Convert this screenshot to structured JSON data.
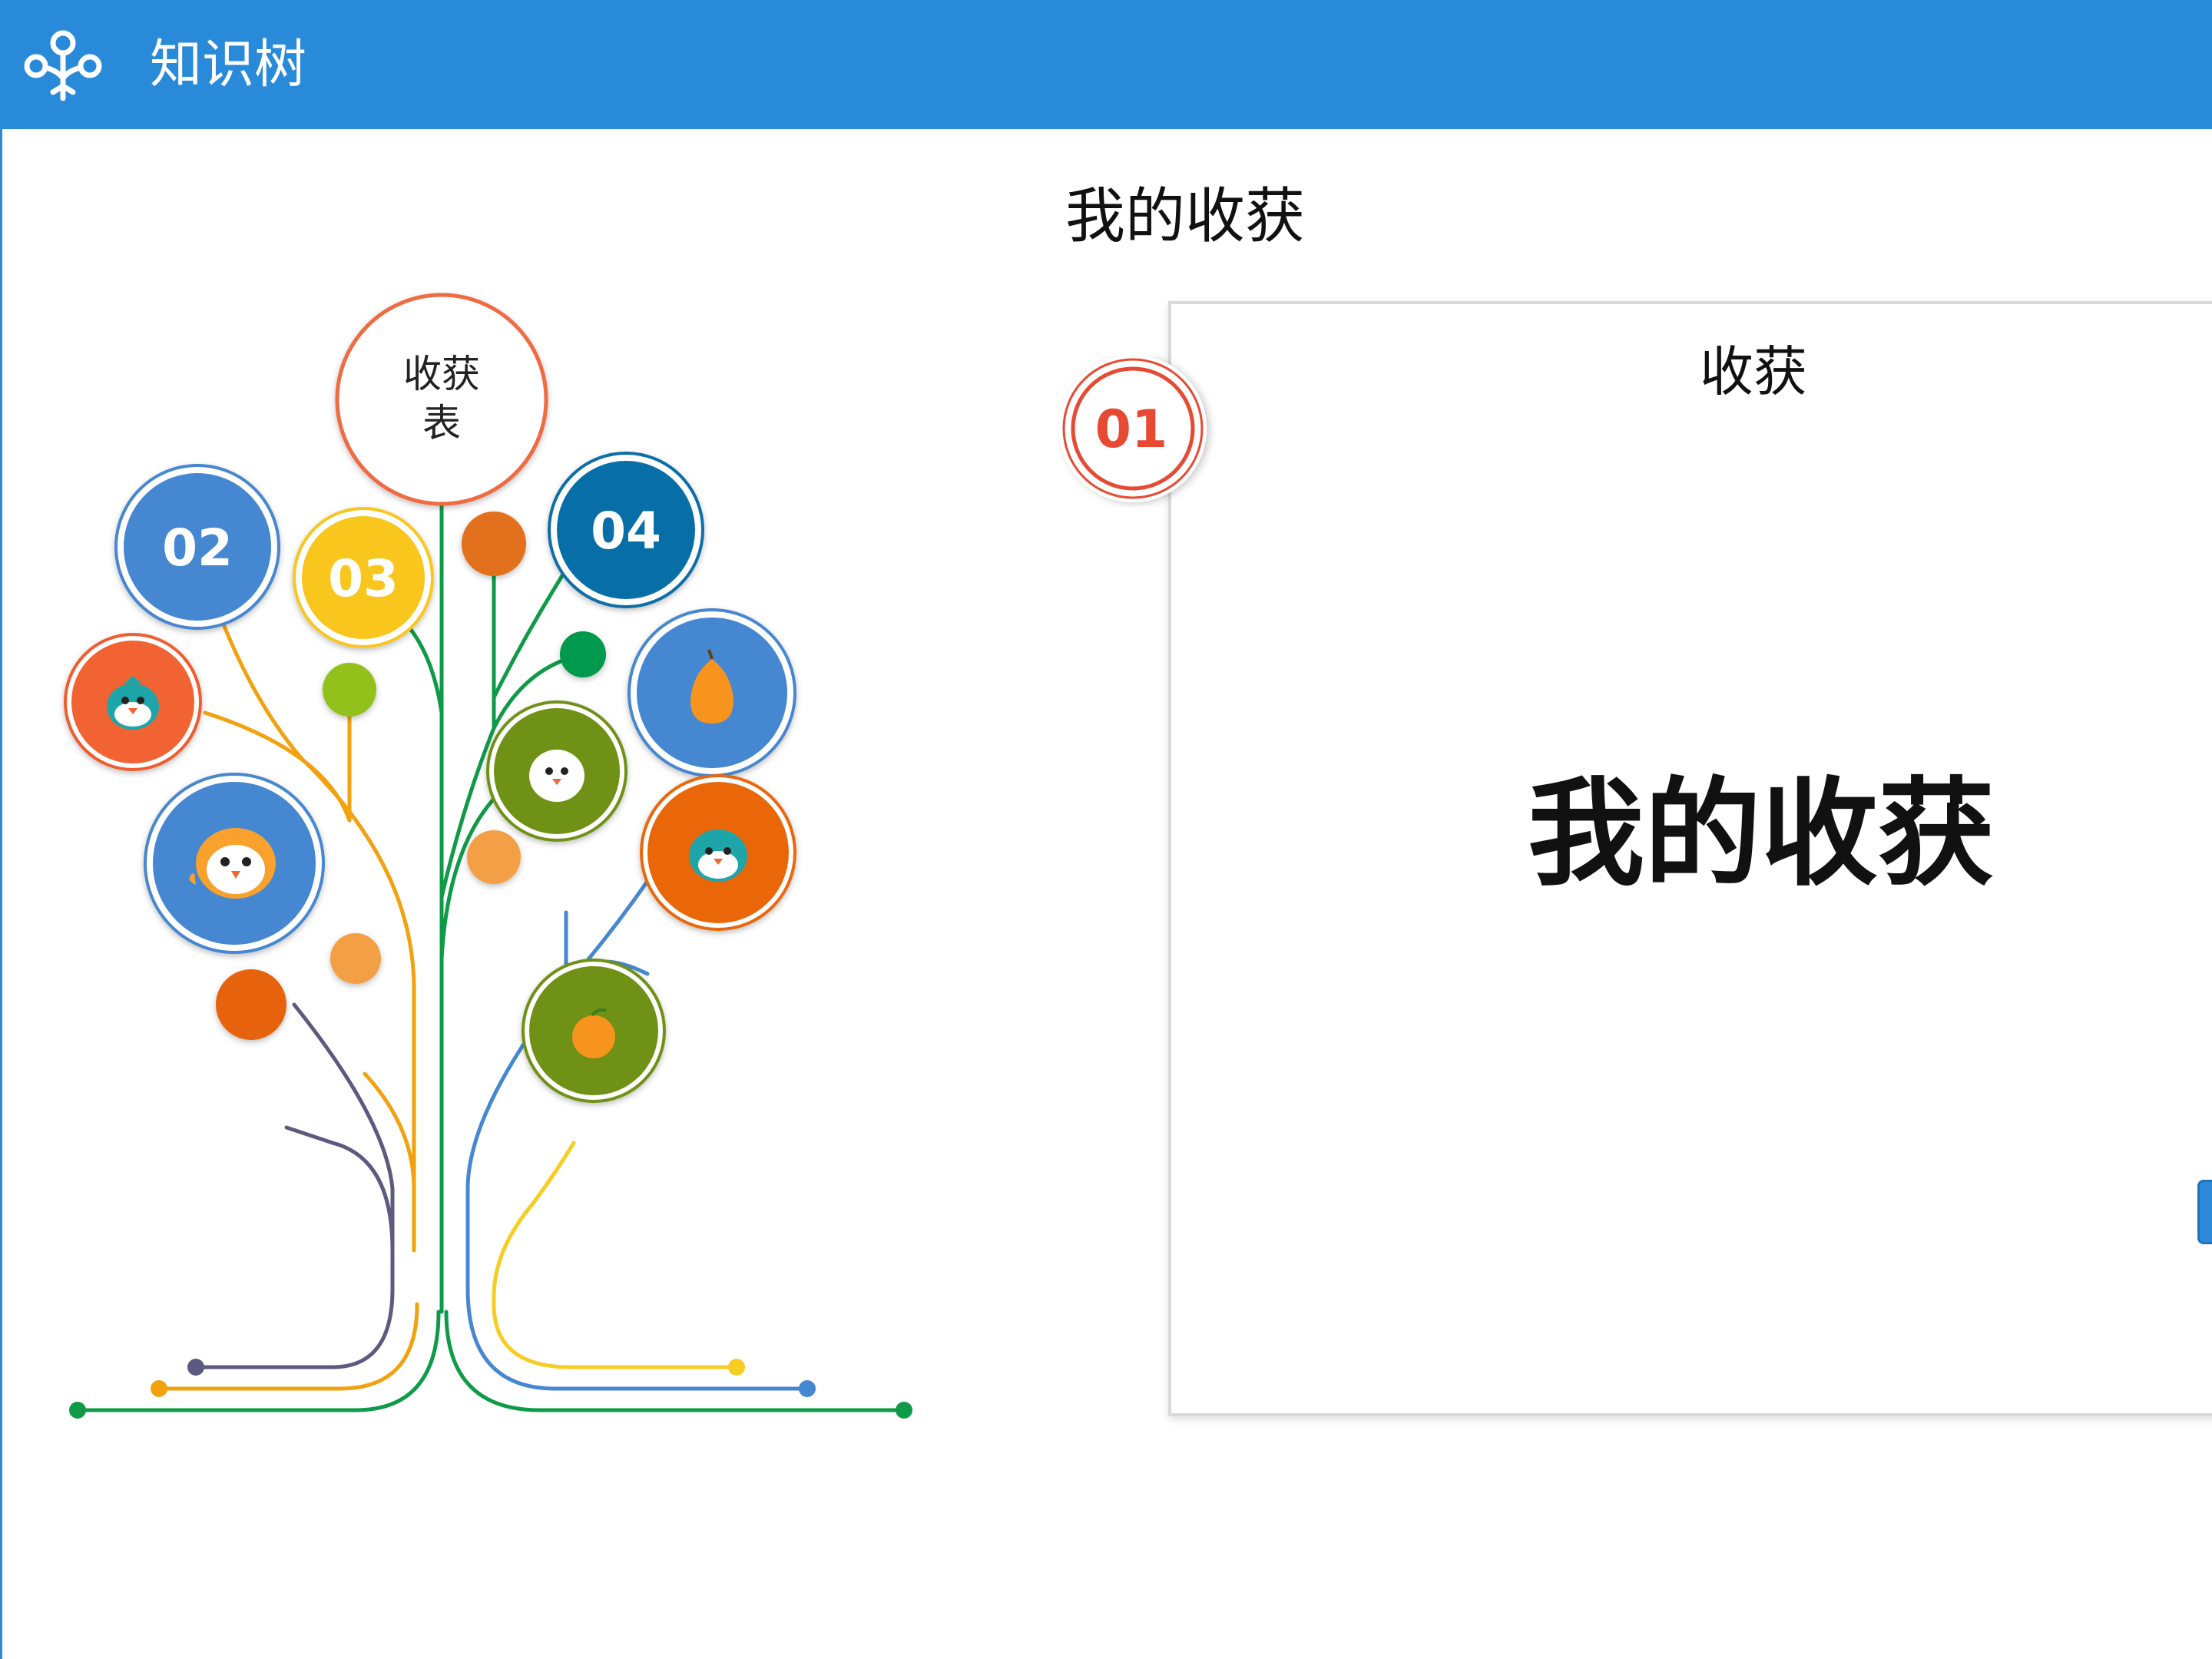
{
  "window": {
    "title": "知识树",
    "icon": "tree-icon",
    "accent_color": "#288ad9"
  },
  "tree": {
    "root_label_line1": "收获",
    "root_label_line2": "表",
    "nodes": [
      {
        "label": "02",
        "color": "#4687d1"
      },
      {
        "label": "03",
        "color": "#f9c61d"
      },
      {
        "label": "04",
        "color": "#076ea8"
      }
    ],
    "fruit_icons": [
      "bird-icon",
      "bird-icon",
      "bird-icon",
      "owl-icon",
      "pear-icon",
      "orange-icon"
    ]
  },
  "main": {
    "heading": "我的收获",
    "card": {
      "badge": "01",
      "title": "收获",
      "body": "我的收获"
    }
  }
}
